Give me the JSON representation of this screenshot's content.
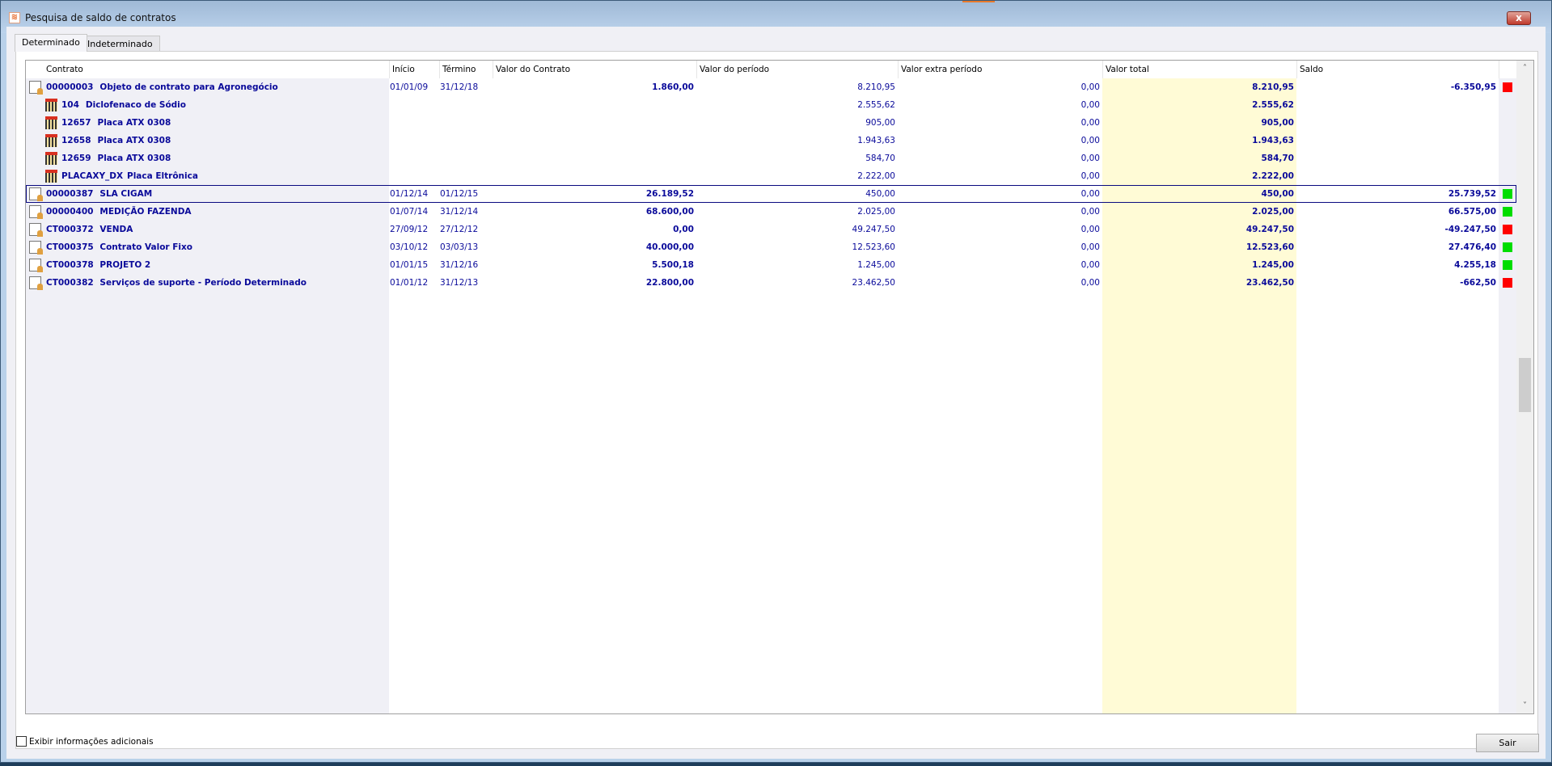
{
  "window": {
    "title": "Pesquisa de saldo de contratos",
    "close_label": "x"
  },
  "tabs": [
    {
      "label": "Determinado"
    },
    {
      "label": "Indeterminado"
    }
  ],
  "columns": {
    "contrato": "Contrato",
    "inicio": "Início",
    "termino": "Término",
    "valor_contrato": "Valor do Contrato",
    "valor_periodo": "Valor do período",
    "valor_extra": "Valor extra período",
    "valor_total": "Valor total",
    "saldo": "Saldo"
  },
  "colors": {
    "text": "#0a0a9a",
    "total_bg": "#fffbd6",
    "contract_bg": "#f0f0f6",
    "green": "#00dd00",
    "red": "#ff0000"
  },
  "rows": [
    {
      "type": "contract",
      "code": "00000003",
      "name": "Objeto de contrato para Agronegócio",
      "inicio": "01/01/09",
      "termino": "31/12/18",
      "valor_contrato": "1.860,00",
      "valor_periodo": "8.210,95",
      "valor_extra": "0,00",
      "valor_total": "8.210,95",
      "saldo": "-6.350,95",
      "status": "red"
    },
    {
      "type": "item",
      "code": "104",
      "name": "Diclofenaco de Sódio",
      "inicio": "",
      "termino": "",
      "valor_contrato": "",
      "valor_periodo": "2.555,62",
      "valor_extra": "0,00",
      "valor_total": "2.555,62",
      "saldo": "",
      "status": ""
    },
    {
      "type": "item",
      "code": "12657",
      "name": "Placa ATX 0308",
      "inicio": "",
      "termino": "",
      "valor_contrato": "",
      "valor_periodo": "905,00",
      "valor_extra": "0,00",
      "valor_total": "905,00",
      "saldo": "",
      "status": ""
    },
    {
      "type": "item",
      "code": "12658",
      "name": "Placa ATX 0308",
      "inicio": "",
      "termino": "",
      "valor_contrato": "",
      "valor_periodo": "1.943,63",
      "valor_extra": "0,00",
      "valor_total": "1.943,63",
      "saldo": "",
      "status": ""
    },
    {
      "type": "item",
      "code": "12659",
      "name": "Placa ATX 0308",
      "inicio": "",
      "termino": "",
      "valor_contrato": "",
      "valor_periodo": "584,70",
      "valor_extra": "0,00",
      "valor_total": "584,70",
      "saldo": "",
      "status": ""
    },
    {
      "type": "item",
      "code": "PLACAXY_DX",
      "name": "Placa Eltrônica",
      "inicio": "",
      "termino": "",
      "valor_contrato": "",
      "valor_periodo": "2.222,00",
      "valor_extra": "0,00",
      "valor_total": "2.222,00",
      "saldo": "",
      "status": ""
    },
    {
      "type": "contract",
      "selected": true,
      "code": "00000387",
      "name": "SLA CIGAM",
      "inicio": "01/12/14",
      "termino": "01/12/15",
      "valor_contrato": "26.189,52",
      "valor_periodo": "450,00",
      "valor_extra": "0,00",
      "valor_total": "450,00",
      "saldo": "25.739,52",
      "status": "green"
    },
    {
      "type": "contract",
      "code": "00000400",
      "name": "MEDIÇÃO FAZENDA",
      "inicio": "01/07/14",
      "termino": "31/12/14",
      "valor_contrato": "68.600,00",
      "valor_periodo": "2.025,00",
      "valor_extra": "0,00",
      "valor_total": "2.025,00",
      "saldo": "66.575,00",
      "status": "green"
    },
    {
      "type": "contract",
      "code": "CT000372",
      "name": "VENDA",
      "inicio": "27/09/12",
      "termino": "27/12/12",
      "valor_contrato": "0,00",
      "valor_periodo": "49.247,50",
      "valor_extra": "0,00",
      "valor_total": "49.247,50",
      "saldo": "-49.247,50",
      "status": "red"
    },
    {
      "type": "contract",
      "code": "CT000375",
      "name": "Contrato Valor Fixo",
      "inicio": "03/10/12",
      "termino": "03/03/13",
      "valor_contrato": "40.000,00",
      "valor_periodo": "12.523,60",
      "valor_extra": "0,00",
      "valor_total": "12.523,60",
      "saldo": "27.476,40",
      "status": "green"
    },
    {
      "type": "contract",
      "code": "CT000378",
      "name": "PROJETO 2",
      "inicio": "01/01/15",
      "termino": "31/12/16",
      "valor_contrato": "5.500,18",
      "valor_periodo": "1.245,00",
      "valor_extra": "0,00",
      "valor_total": "1.245,00",
      "saldo": "4.255,18",
      "status": "green"
    },
    {
      "type": "contract",
      "code": "CT000382",
      "name": "Serviços de suporte - Período Determinado",
      "inicio": "01/01/12",
      "termino": "31/12/13",
      "valor_contrato": "22.800,00",
      "valor_periodo": "23.462,50",
      "valor_extra": "0,00",
      "valor_total": "23.462,50",
      "saldo": "-662,50",
      "status": "red"
    }
  ],
  "footer": {
    "checkbox_label": "Exibir informações adicionais",
    "exit_label": "Sair"
  }
}
